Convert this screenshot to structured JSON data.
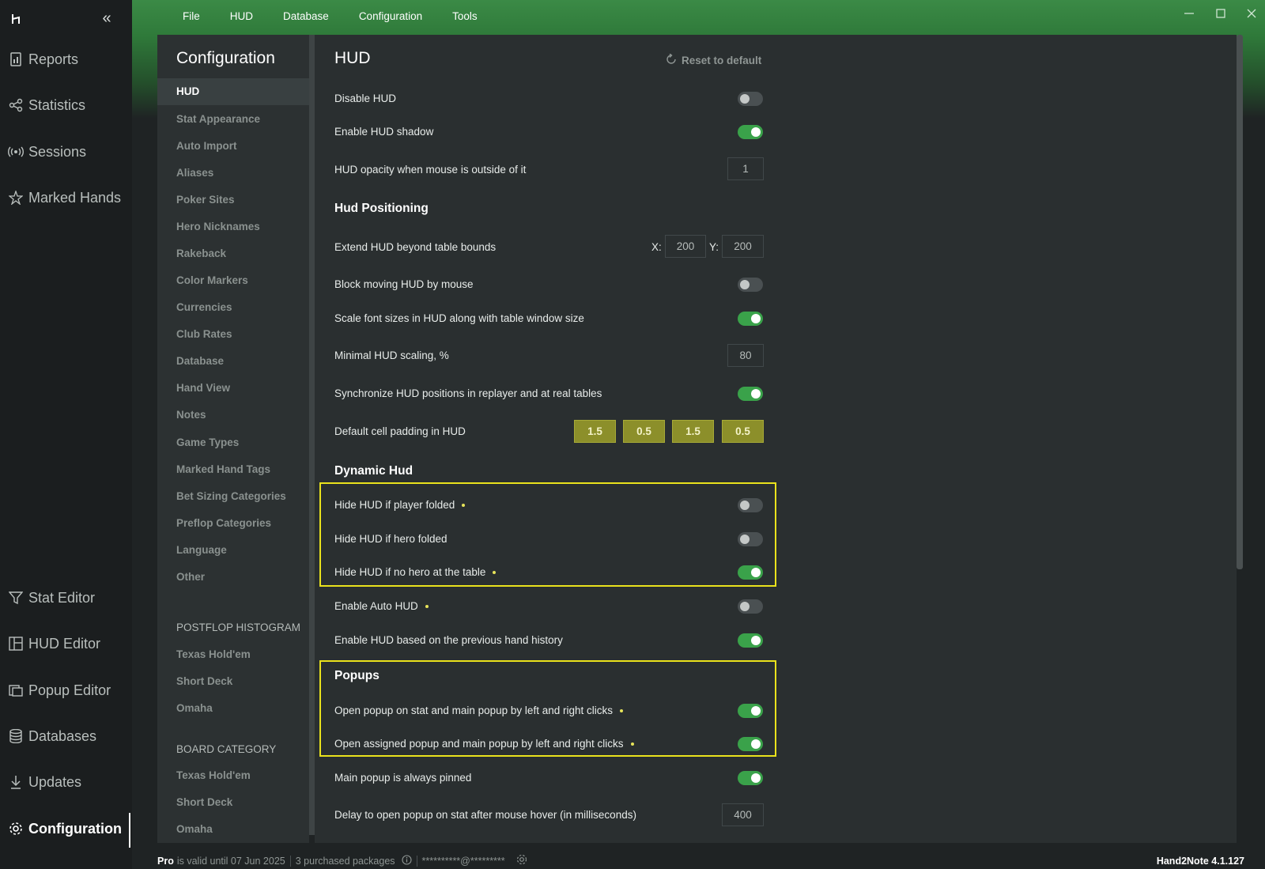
{
  "menu": [
    "File",
    "HUD",
    "Database",
    "Configuration",
    "Tools"
  ],
  "rail": {
    "items": [
      {
        "label": "Reports",
        "icon": "reports-icon"
      },
      {
        "label": "Statistics",
        "icon": "statistics-icon"
      },
      {
        "label": "Sessions",
        "icon": "sessions-icon"
      },
      {
        "label": "Marked Hands",
        "icon": "marked-hands-icon"
      }
    ],
    "bottom_items": [
      {
        "label": "Stat Editor",
        "icon": "filter-icon"
      },
      {
        "label": "HUD Editor",
        "icon": "hud-editor-icon"
      },
      {
        "label": "Popup Editor",
        "icon": "popup-editor-icon"
      },
      {
        "label": "Databases",
        "icon": "database-icon"
      },
      {
        "label": "Updates",
        "icon": "download-icon"
      },
      {
        "label": "Configuration",
        "icon": "gear-icon"
      }
    ]
  },
  "config": {
    "title": "Configuration",
    "nav": [
      "HUD",
      "Stat Appearance",
      "Auto Import",
      "Aliases",
      "Poker Sites",
      "Hero Nicknames",
      "Rakeback",
      "Color Markers",
      "Currencies",
      "Club Rates",
      "Database",
      "Hand View",
      "Notes",
      "Game Types",
      "Marked Hand Tags",
      "Bet Sizing Categories",
      "Preflop Categories",
      "Language",
      "Other"
    ],
    "postflop_header": "POSTFLOP HISTOGRAM",
    "postflop_items": [
      "Texas Hold'em",
      "Short Deck",
      "Omaha"
    ],
    "board_header": "BOARD CATEGORY",
    "board_items": [
      "Texas Hold'em",
      "Short Deck",
      "Omaha"
    ]
  },
  "hud": {
    "title": "HUD",
    "reset_label": "Reset to default",
    "disable_hud": "Disable HUD",
    "enable_shadow": "Enable HUD shadow",
    "opacity_label": "HUD opacity when mouse is outside of it",
    "opacity_value": "1",
    "positioning_header": "Hud Positioning",
    "extend_label": "Extend HUD beyond table bounds",
    "x_label": "X:",
    "x_value": "200",
    "y_label": "Y:",
    "y_value": "200",
    "block_moving": "Block moving HUD by mouse",
    "scale_font": "Scale font sizes in HUD along with table window size",
    "min_scaling_label": "Minimal HUD scaling, %",
    "min_scaling_value": "80",
    "sync_positions": "Synchronize HUD positions in replayer and at real tables",
    "padding_label": "Default cell padding in HUD",
    "padding_values": [
      "1.5",
      "0.5",
      "1.5",
      "0.5"
    ],
    "dynamic_header": "Dynamic Hud",
    "hide_player_folded": "Hide HUD if player folded",
    "hide_hero_folded": "Hide HUD if hero folded",
    "hide_no_hero": "Hide HUD if no hero at the table",
    "enable_auto": "Enable Auto HUD",
    "enable_prev_history": "Enable HUD based on the previous hand history",
    "popups_header": "Popups",
    "open_popup_stat": "Open popup on stat and main popup by left and right clicks",
    "open_assigned": "Open assigned popup and main popup by left and right clicks",
    "main_pinned": "Main popup is always pinned",
    "delay_label": "Delay to open popup on stat after mouse hover (in milliseconds)",
    "delay_value": "400"
  },
  "toggles": {
    "disable_hud": false,
    "enable_shadow": true,
    "block_moving": false,
    "scale_font": true,
    "sync_positions": true,
    "hide_player_folded": false,
    "hide_hero_folded": false,
    "hide_no_hero": true,
    "enable_auto": false,
    "enable_prev_history": true,
    "open_popup_stat": true,
    "open_assigned": true,
    "main_pinned": true
  },
  "status": {
    "plan": "Pro",
    "validity": "is valid until 07 Jun 2025",
    "packages": "3 purchased packages",
    "email": "**********@*********",
    "version": "Hand2Note 4.1.127"
  },
  "colors": {
    "accent": "#3aa24a",
    "highlight": "#eae21c",
    "pad": "#8c8f2a"
  }
}
